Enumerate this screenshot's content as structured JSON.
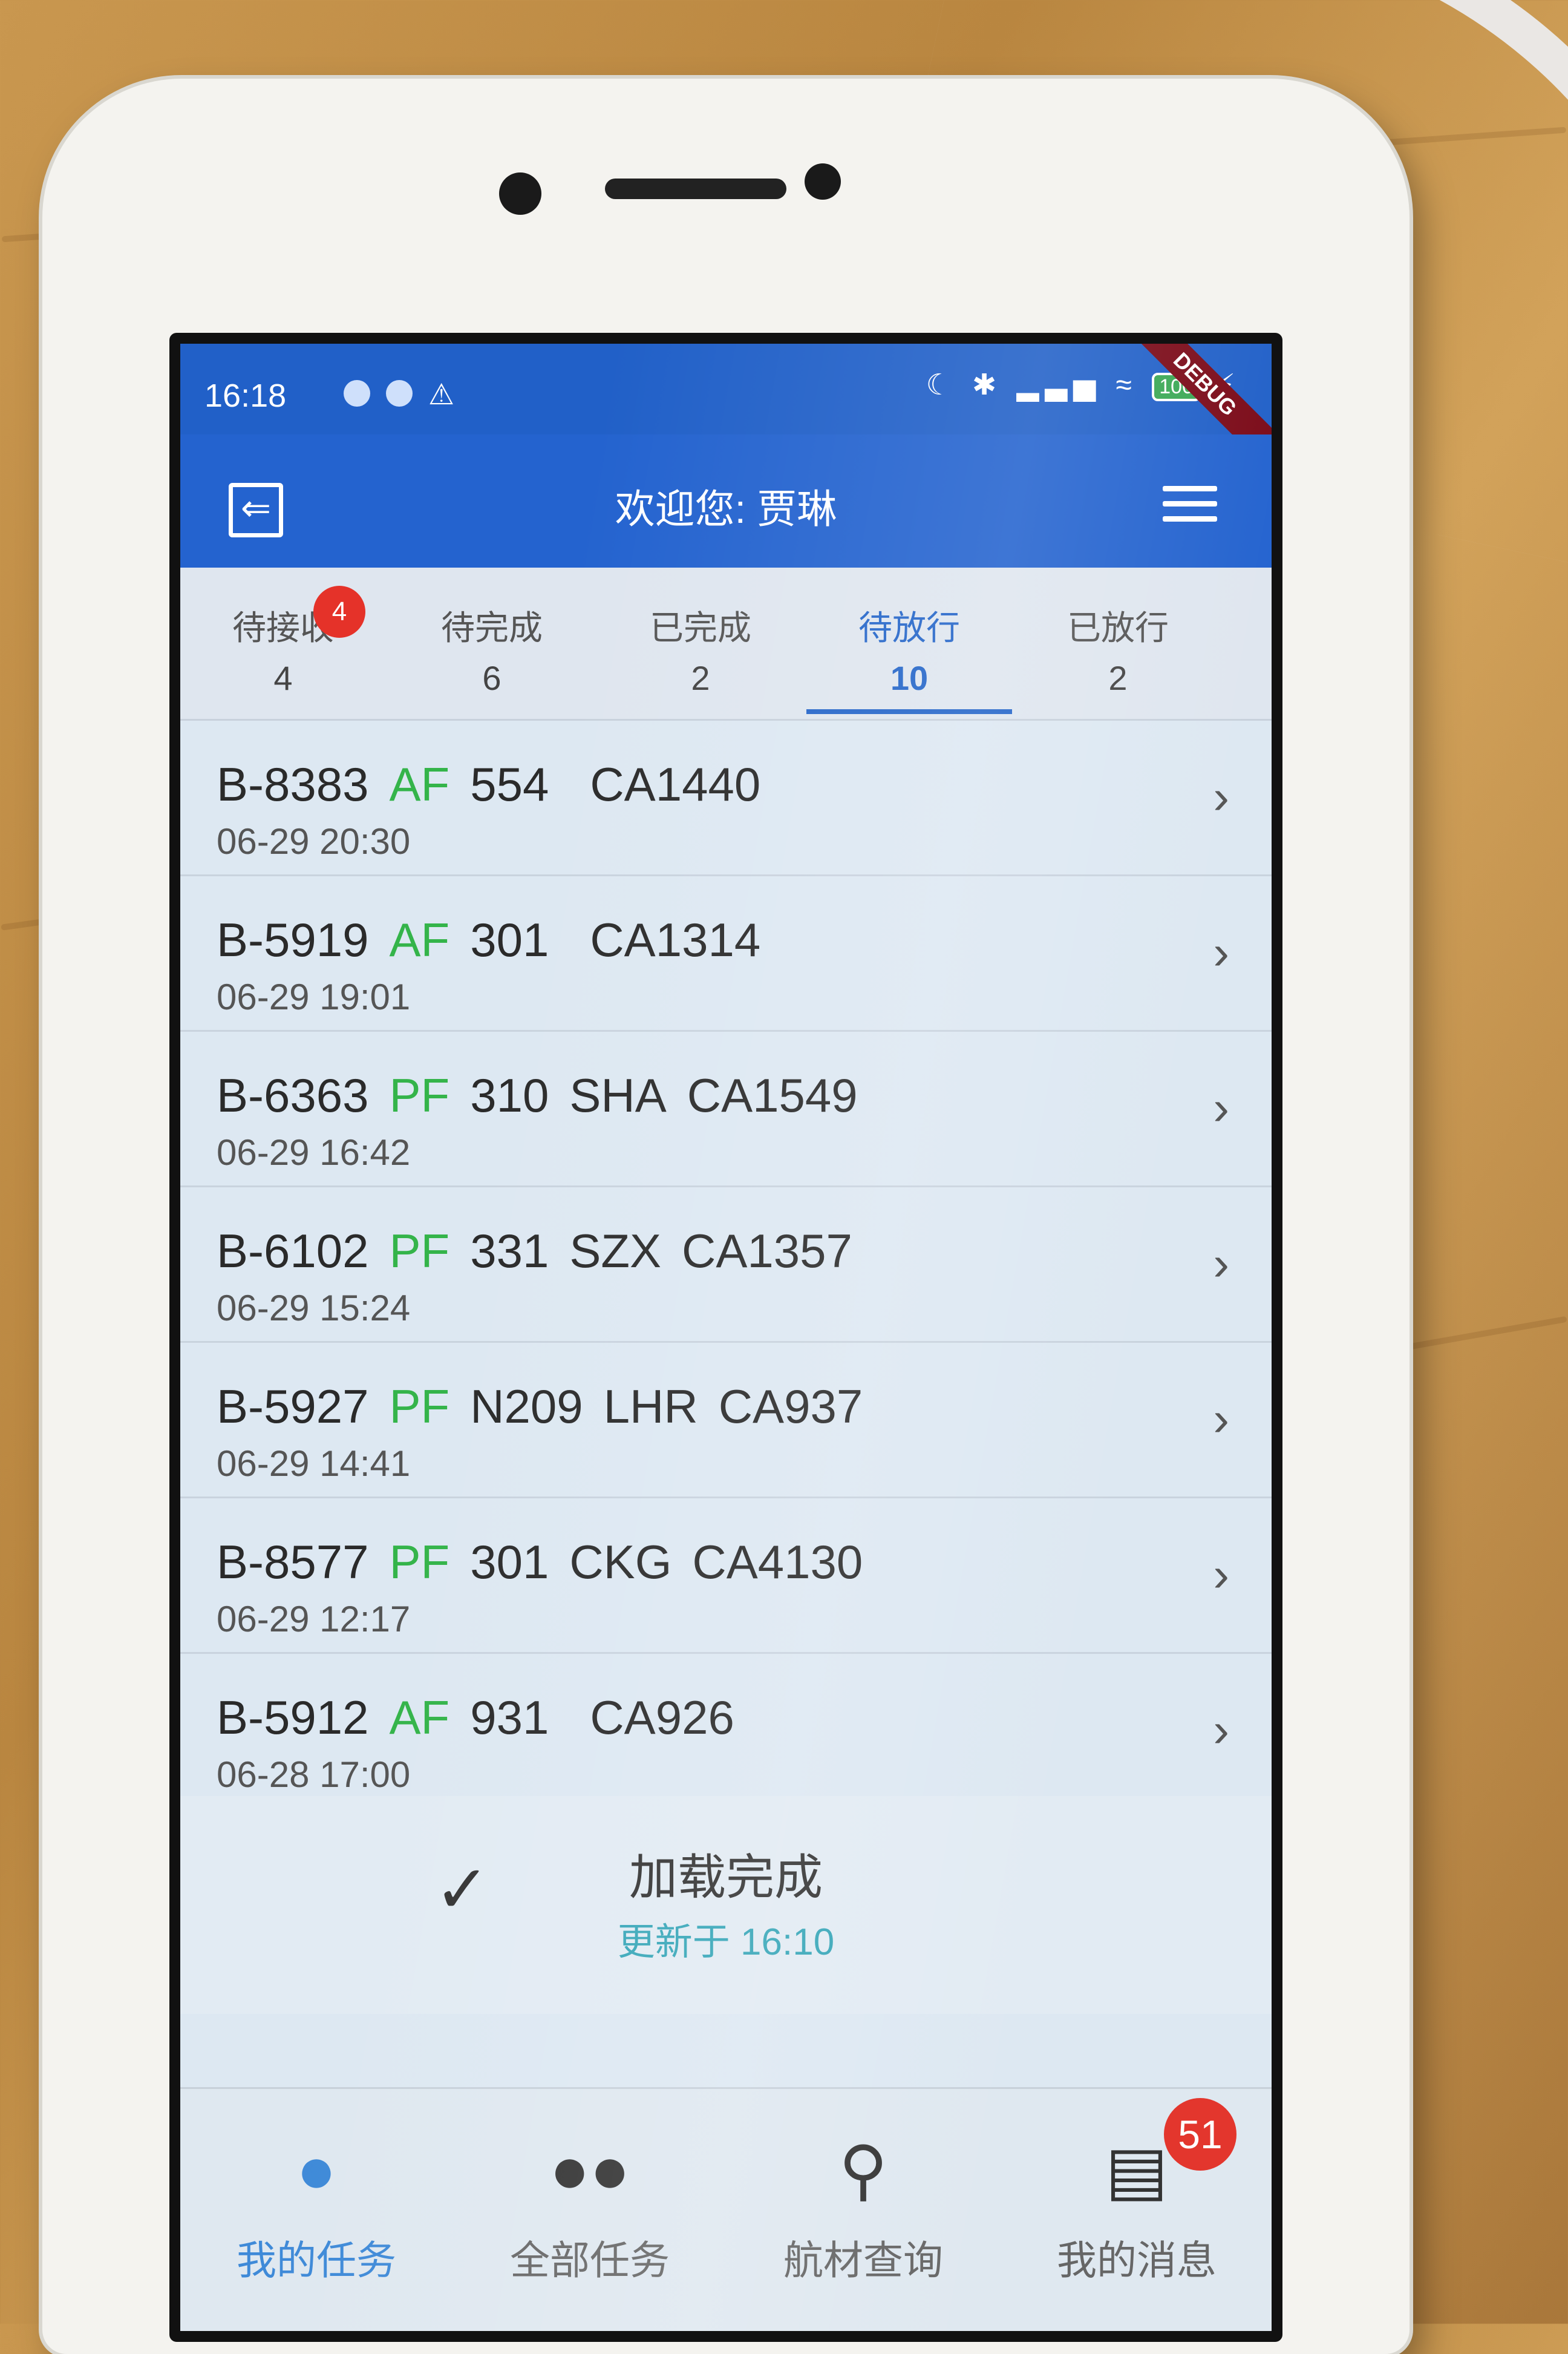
{
  "status_bar": {
    "time": "16:18",
    "battery": "100",
    "debug_banner": "DEBUG",
    "icons": [
      "notification-dot-icon",
      "notification-dot-icon",
      "warning-icon",
      "moon-icon",
      "bluetooth-icon",
      "signal-icon",
      "wifi-icon",
      "battery-icon",
      "charging-icon"
    ]
  },
  "app_bar": {
    "title": "欢迎您: 贾琳",
    "back_icon": "exit-icon",
    "menu_icon": "menu-icon",
    "color": "#2463cf"
  },
  "tabs": [
    {
      "label": "待接收",
      "count": "4",
      "badge": "4"
    },
    {
      "label": "待完成",
      "count": "6"
    },
    {
      "label": "已完成",
      "count": "2"
    },
    {
      "label": "待放行",
      "count": "10",
      "active": true
    },
    {
      "label": "已放行",
      "count": "2"
    }
  ],
  "tasks": [
    {
      "reg": "B-8383",
      "status": "AF",
      "code": "554",
      "station": "",
      "flight": "CA1440",
      "time": "06-29 20:30"
    },
    {
      "reg": "B-5919",
      "status": "AF",
      "code": "301",
      "station": "",
      "flight": "CA1314",
      "time": "06-29 19:01"
    },
    {
      "reg": "B-6363",
      "status": "PF",
      "code": "310",
      "station": "SHA",
      "flight": "CA1549",
      "time": "06-29 16:42"
    },
    {
      "reg": "B-6102",
      "status": "PF",
      "code": "331",
      "station": "SZX",
      "flight": "CA1357",
      "time": "06-29 15:24"
    },
    {
      "reg": "B-5927",
      "status": "PF",
      "code": "N209",
      "station": "LHR",
      "flight": "CA937",
      "time": "06-29 14:41"
    },
    {
      "reg": "B-8577",
      "status": "PF",
      "code": "301",
      "station": "CKG",
      "flight": "CA4130",
      "time": "06-29 12:17"
    },
    {
      "reg": "B-5912",
      "status": "AF",
      "code": "931",
      "station": "",
      "flight": "CA926",
      "time": "06-28 17:00"
    }
  ],
  "footer": {
    "loaded": "加载完成",
    "updated": "更新于 16:10"
  },
  "bottom_nav": [
    {
      "label": "我的任务",
      "icon": "person-icon",
      "active": true
    },
    {
      "label": "全部任务",
      "icon": "group-icon"
    },
    {
      "label": "航材查询",
      "icon": "search-icon"
    },
    {
      "label": "我的消息",
      "icon": "message-icon",
      "badge": "51"
    }
  ],
  "colors": {
    "status_green": "#34b44a",
    "accent_blue": "#2566c9",
    "badge_red": "#e53229"
  }
}
